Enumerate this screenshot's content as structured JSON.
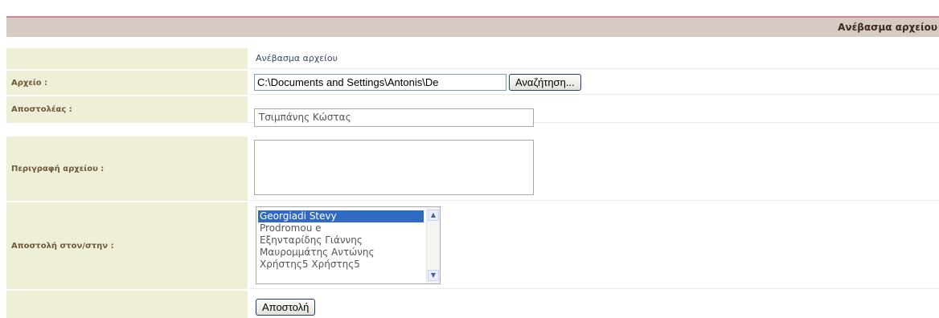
{
  "header": {
    "title": "Ανέβασμα αρχείου"
  },
  "form": {
    "section_title": "Ανέβασμα αρχείου",
    "file_label": "Αρχείο :",
    "file_value": "C:\\Documents and Settings\\Antonis\\De",
    "browse_label": "Αναζήτηση...",
    "sender_label": "Αποστολέας :",
    "sender_value": "Τσιμπάνης Κώστας",
    "description_label": "Περιγραφή αρχείου :",
    "description_value": "",
    "recipients_label": "Αποστολή στον/στην :",
    "recipients": [
      "Georgiadi Stevy",
      "Prodromou e",
      "Εξηνταρίδης Γιάννης",
      "Μαυρομμάτης Αντώνης",
      "Χρήστης5 Χρήστης5"
    ],
    "selected_recipient": "Georgiadi Stevy",
    "submit_label": "Αποστολή"
  },
  "icons": {
    "scroll_up": "scroll-up-arrow-icon",
    "scroll_down": "scroll-down-arrow-icon"
  },
  "colors": {
    "header_bg": "#d6cbc3",
    "header_border": "#c98a8d",
    "label_bg": "#efefd8",
    "selection": "#316ac5"
  }
}
